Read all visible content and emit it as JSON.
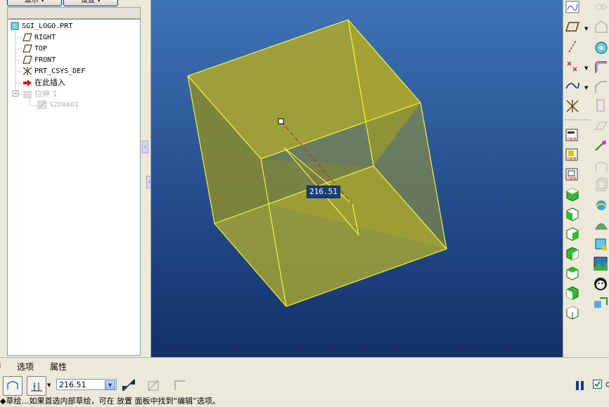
{
  "top_buttons": [
    {
      "label": "显示 ▾"
    },
    {
      "label": "设置 ▾"
    }
  ],
  "model_tree": {
    "items": [
      {
        "label": "SGI_LOGO.PRT",
        "icon": "part-icon",
        "disabled": false
      },
      {
        "label": "RIGHT",
        "icon": "datum-plane-icon",
        "disabled": false
      },
      {
        "label": "TOP",
        "icon": "datum-plane-icon",
        "disabled": false
      },
      {
        "label": "FRONT",
        "icon": "datum-plane-icon",
        "disabled": false
      },
      {
        "label": "PRT_CSYS_DEF",
        "icon": "csys-icon",
        "disabled": false
      },
      {
        "label": "在此插入",
        "icon": "insert-here-arrow-icon",
        "disabled": false
      },
      {
        "label": "拉伸 1",
        "icon": "extrude-icon",
        "disabled": true
      },
      {
        "label": "S2D0001",
        "icon": "sketch-icon",
        "disabled": true
      }
    ]
  },
  "viewport": {
    "dimension_value": "216.51"
  },
  "dashboard": {
    "tabs": [
      {
        "label": "选项"
      },
      {
        "label": "属性"
      }
    ],
    "depth_value": "216.51",
    "status_message": "◆草绘…如果首选内部草绘，可在 放置 面板中找到“编辑”选项。"
  },
  "colors": {
    "viewport_top": "#3d74b6",
    "viewport_bottom": "#13306a",
    "solid_fill": "#a6a432",
    "solid_edge": "#ffff3a"
  }
}
